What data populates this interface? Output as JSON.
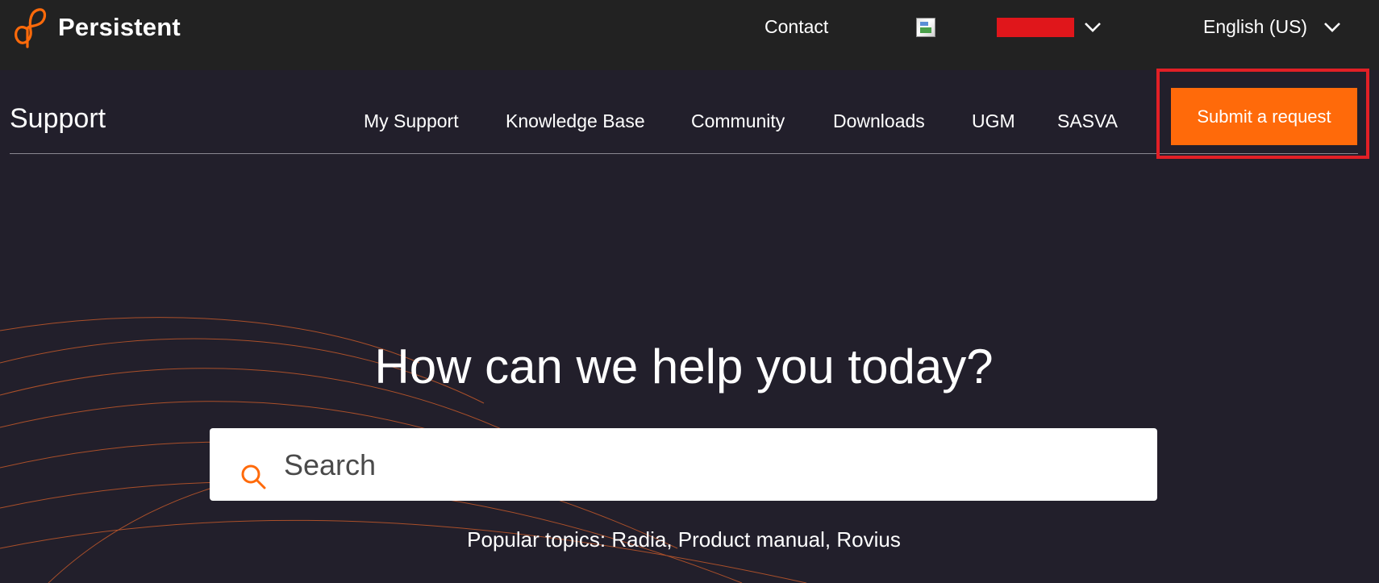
{
  "colors": {
    "accent": "#ff6a0a",
    "topbar_bg": "#222222",
    "page_bg": "#221f2b",
    "highlight_outline": "#e21f26",
    "redaction": "#e0161b"
  },
  "header": {
    "brand": "Persistent",
    "logo_icon": "persistent-logo-icon",
    "contact_label": "Contact",
    "user_menu": {
      "avatar_icon": "broken-image-icon",
      "name": "",
      "chevron_icon": "chevron-down-icon"
    },
    "language": {
      "selected": "English (US)",
      "chevron_icon": "chevron-down-icon"
    }
  },
  "support_nav": {
    "title": "Support",
    "items": [
      {
        "label": "My Support"
      },
      {
        "label": "Knowledge Base"
      },
      {
        "label": "Community"
      },
      {
        "label": "Downloads"
      },
      {
        "label": "UGM"
      },
      {
        "label": "SASVA"
      }
    ],
    "submit_label": "Submit a request"
  },
  "hero": {
    "title": "How can we help you today?",
    "search": {
      "placeholder": "Search",
      "value": "",
      "icon": "search-icon"
    },
    "popular_prefix": "Popular topics:",
    "popular_topics": [
      "Radia",
      "Product manual",
      "Rovius"
    ]
  }
}
